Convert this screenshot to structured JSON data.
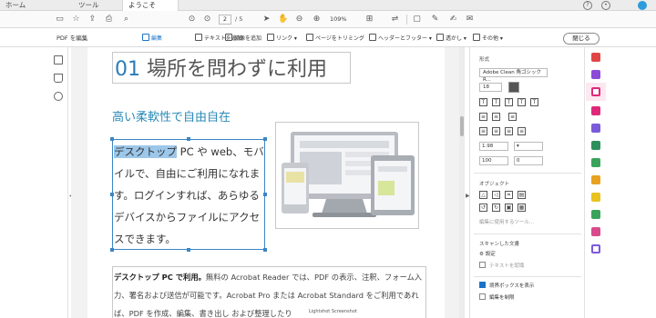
{
  "tabs": {
    "home": "ホーム",
    "tools": "ツール",
    "document": "ようこそ"
  },
  "toolbar": {
    "page_current": "2",
    "page_total": "/ 5",
    "zoom": "109%"
  },
  "editbar": {
    "title": "PDF を編集",
    "buttons": [
      "編集",
      "テキストを追加",
      "画像を追加",
      "リンク",
      "ページをトリミング",
      "ヘッダーとフッター",
      "透かし",
      "その他"
    ],
    "close_label": "閉じる"
  },
  "document": {
    "title_number": "01",
    "title_text": " 場所を問わずに利用",
    "subtitle": "高い柔軟性で自由自在",
    "body_selected": "デスクトップ",
    "body_rest": " PC や web、モバイルで、自由にご利用になれます。ログインすれば、あらゆるデバイスからファイルにアクセスできます。",
    "para_bold": "デスクトップ PC で利用。",
    "para_text": "無料の Acrobat Reader では、PDF の表示、注釈、フォーム入力、署名および送信が可能です。Acrobat Pro または Acrobat Standard をご利用であれば、PDF を作成、編集、書き出し および整理したり",
    "watermark": "Lightshot Screenshot"
  },
  "panel": {
    "format_title": "形式",
    "font": "Adobe Clean 角ゴシック R...",
    "size": "18",
    "line_spacing": "1.98",
    "char_spacing": "0",
    "scale": "100",
    "tracking": "0",
    "objects_title": "オブジェクト",
    "edit_with_tool": "編集に使用するツール...",
    "scanned_title": "スキャンした文書",
    "settings": "設定",
    "recognize_text": "テキストを認識",
    "show_bounding": "境界ボックスを表示",
    "restrict_edit": "編集を制限"
  },
  "colors": {
    "accent": "#1a73c9",
    "heading_blue": "#2a8ab6",
    "selection": "#9cc7ea",
    "pink": "#e0287a"
  },
  "rail_icons": [
    "create-pdf-icon",
    "export-pdf-icon",
    "edit-pdf-icon",
    "comment-icon",
    "fill-sign-icon",
    "organize-pages-icon",
    "export-excel-icon",
    "protect-icon",
    "more-tools-icon"
  ]
}
